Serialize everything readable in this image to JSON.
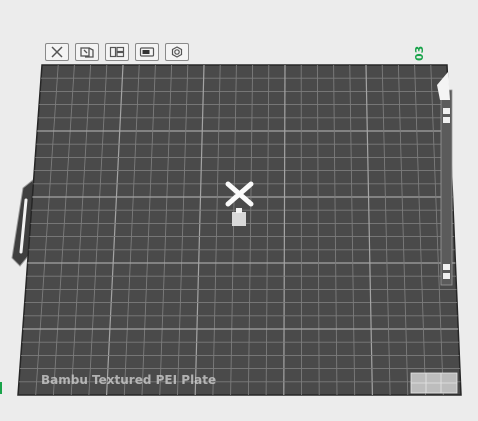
{
  "plate": {
    "label": "Bambu Textured PEI Plate",
    "number": "03"
  },
  "toolbar": {
    "buttons": [
      {
        "name": "close-plate-button",
        "icon": "close-x-icon"
      },
      {
        "name": "auto-orient-button",
        "icon": "orient-icon"
      },
      {
        "name": "arrange-button",
        "icon": "arrange-icon"
      },
      {
        "name": "lock-plate-button",
        "icon": "lock-toggle-icon"
      },
      {
        "name": "plate-settings-button",
        "icon": "gear-icon"
      }
    ]
  },
  "colors": {
    "bed": "#4a4a4a",
    "grid": "#7e7e7e",
    "plate_number": "#19a34a",
    "background": "#ececec"
  }
}
